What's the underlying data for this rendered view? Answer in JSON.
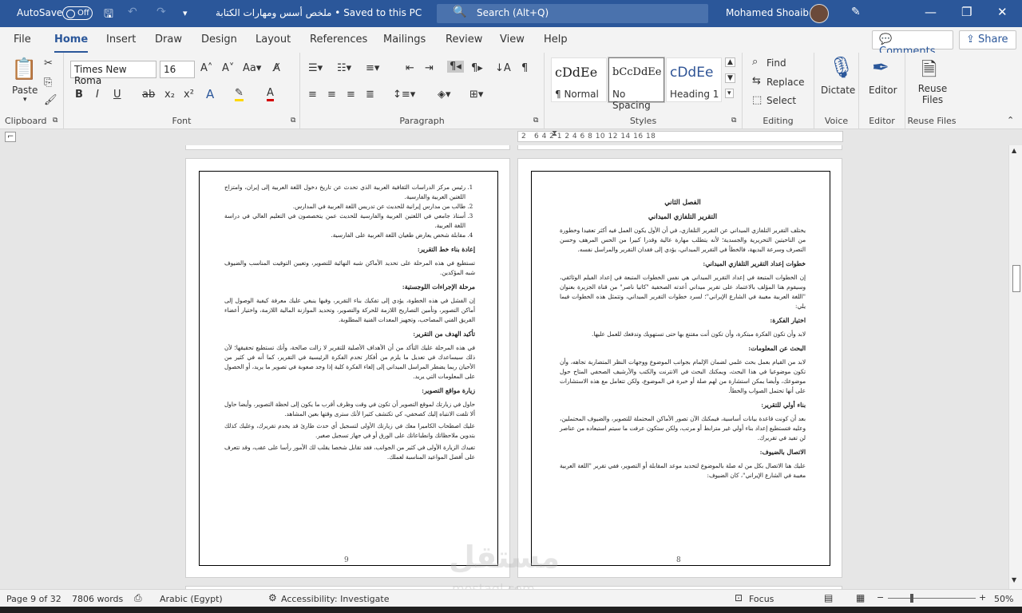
{
  "titlebar": {
    "autosave_label": "AutoSave",
    "autosave_state": "Off",
    "doc_title": "ملخص أسس ومهارات الكتابة • Saved to this PC",
    "search_placeholder": "Search (Alt+Q)",
    "user_name": "Mohamed Shoaib"
  },
  "tabs": [
    "File",
    "Home",
    "Insert",
    "Draw",
    "Design",
    "Layout",
    "References",
    "Mailings",
    "Review",
    "View",
    "Help"
  ],
  "active_tab": "Home",
  "actions": {
    "comments": "Comments",
    "share": "Share"
  },
  "ribbon": {
    "clipboard": {
      "label": "Clipboard",
      "paste": "Paste"
    },
    "font": {
      "label": "Font",
      "font_name": "Times New Roma",
      "font_size": "16"
    },
    "paragraph": {
      "label": "Paragraph"
    },
    "styles": {
      "label": "Styles",
      "items": [
        {
          "preview": "cDdEe",
          "name": "¶ Normal"
        },
        {
          "preview": "bCcDdEe",
          "name": "No Spacing"
        },
        {
          "preview": "cDdEe",
          "name": "Heading 1"
        }
      ]
    },
    "editing": {
      "label": "Editing",
      "find": "Find",
      "replace": "Replace",
      "select": "Select"
    },
    "voice": {
      "label": "Voice",
      "dictate": "Dictate"
    },
    "editor": {
      "label": "Editor",
      "editor": "Editor"
    },
    "reuse": {
      "label": "Reuse Files",
      "reuse": "Reuse Files"
    }
  },
  "ruler": {
    "left": "2",
    "marks": "6  4  2  1  2  4  6  8  10  12  14  16  18"
  },
  "pages": {
    "right": {
      "chapter": "الفصل الثاني",
      "title": "التقرير التلفازي الميداني",
      "intro": "يختلف التقرير التلفازي الميداني عن التقرير التلفازي، في أن الأول يكون العمل فيه أكثر تعقيدا وخطورة من الناحيتين التحريرية والجسدية؛ لأنه يتطلب مهارة عالية وقدرا كبيرا من الحس المرهف وحسن التصرف وسرعة البديهة، فالخطأ في التقرير الميداني، يؤدي إلى فقدان التقرير والمراسل نفسه.",
      "h1": "خطوات إعداد التقرير التلفازي الميداني:",
      "p1": "إن الخطوات المتبعة في إعداد التقرير الميداني هي نفس الخطوات المتبعة في إعداد الفيلم الوثائقي، وسيقوم هنا المؤلف بالاعتماد على تقرير ميداني أعدته الصحفية \"كاتيا ناصر\" من قناة الجزيرة بعنوان \"اللغة العربية مغيبة في الشارع الإيراني\"؛ لسرد خطوات التقرير الميداني، وتتمثل هذه الخطوات فيما يلي:",
      "h2": "اختيار الفكرة:",
      "p2": "لابد وأن تكون الفكرة مبتكرة، وأن تكون أنت مقتنع بها حتى تستهويك وتدفعك للعمل عليها.",
      "h3": "البحث عن المعلومات:",
      "p3": "لابد من القيام بعمل بحث علمي لضمان الإلمام بجوانب الموضوع ووجهات النظر المتضاربة تجاهه، وأن تكون موضوعيا في هذا البحث، ويمكنك البحث في الانترنت والكتب والأرشيف الصحفي المتاح حول موضوعك، وأيضا يمكن استشارة من لهم صلة أو خبرة في الموضوع، ولكن تتعامل مع هذه الاستشارات على أنها تحتمل الصواب والخطأ.",
      "h4": "بناء أولي للتقرير:",
      "p4": "بعد أن كونت قاعدة بيانات أساسية، فيمكنك الآن تصور الأماكن المحتملة للتصوير، والضيوف المحتملين، وعليه فتستطيع إعداد بناء أولي غير مترابط أو مرتب، ولكن ستكون عرفت ما سيتم استبعاده من عناصر لن تفيد في تقريرك.",
      "h5": "الاتصال بالضيوف:",
      "p5": "عليك هنا الاتصال بكل من له صلة بالموضوع لتحديد موعد المقابلة أو التصوير، ففي تقرير \"اللغة العربية مغيبة في الشارع الإيراني\"، كان الضيوف:",
      "page_number": "8"
    },
    "left": {
      "list": [
        "رئيس مركز الدراسات الثقافية العربية الذي تحدث عن تاريخ دخول اللغة العربية إلى إيران، وامتزاج اللغتين العربية والفارسية.",
        "طالب من مدارس إيرانية للحديث عن تدريس اللغة العربية في المدارس.",
        "أستاذ جامعي في اللغتين العربية والفارسية للحديث عمن يتخصصون في التعليم العالي في دراسة اللغة العربية.",
        "مقابلة شخص يعارض طغيان اللغة العربية على الفارسية."
      ],
      "h1": "إعادة بناء خط التقرير:",
      "p1": "تستطيع في هذه المرحلة على تحديد الأماكن شبه النهائية للتصوير، وتعيين التوقيت المناسب والضيوف شبه المؤكدين.",
      "h2": "مرحلة الإجراءات اللوجستية:",
      "p2": "إن الفشل في هذه الخطوة، يؤدي إلى تفكيك بناء التقرير، وفيها ينبغي عليك معرفة كيفية الوصول إلى أماكن التصوير، وتأمين التصاريح اللازمة للحركة والتصوير، وتحديد الموازنة المالية اللازمة، واختيار أعضاء الفريق الفني المصاحب، وتجهيز المعدات الفنية المطلوبة.",
      "h3": "تأكيد الهدف من التقرير:",
      "p3": "في هذه المرحلة عليك التأكد من أن الأهداف الأصلية للتقرير لا زالت صالحة، وأنك تستطيع تحقيقها؛ لأن ذلك سيساعدك في تعديل ما يلزم من أفكار تخدم الفكرة الرئيسية في التقرير، كما أنه في كثير من الأحيان ربما يضطر المراسل الميداني إلى إلغاء الفكرة كلية إذا وجد صعوبة في تصوير ما يريد، أو الحصول على المعلومات التي يريد.",
      "h4": "زيارة مواقع التصوير:",
      "p4": "حاول في زيارتك لموقع التصوير أن تكون في وقت وظرف أقرب ما يكون إلى لحظة التصوير، وأيضا حاول ألا تلفت الانتباه إليك كصحفي، كي تكتشف كثيرا لأنك سترى وقتها بعين المشاهد.",
      "p5": "عليك اصطحاب الكاميرا معك في زيارتك الأولى لتسجيل أي حدث طارئ قد يخدم تقريرك، وعليك كذلك بتدوين ملاحظاتك وانطباعاتك على الورق أو في جهاز تسجيل صغير.",
      "p6": "تفيدك الزيارة الأولى في كثير من الجوانب، فقد تقابل شخصا يقلب لك الأمور رأسا على عقب، وقد تتعرف على أفضل المواعيد المناسبة لعملك.",
      "page_number": "9"
    }
  },
  "status": {
    "page": "Page 9 of 32",
    "words": "7806 words",
    "language": "Arabic (Egypt)",
    "accessibility": "Accessibility: Investigate",
    "focus": "Focus",
    "zoom": "50%"
  },
  "watermark": {
    "text": "مستقل",
    "sub": "mostaql.com"
  }
}
